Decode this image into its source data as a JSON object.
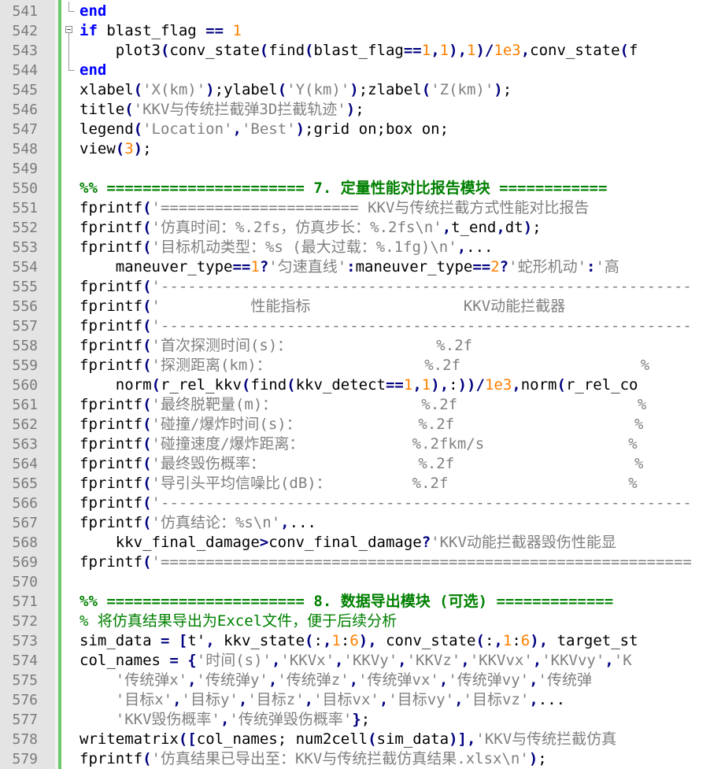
{
  "editor": {
    "lines": [
      {
        "n": "541",
        "fold": "end",
        "tokens": [
          [
            "kw",
            "end"
          ]
        ]
      },
      {
        "n": "542",
        "fold": "start",
        "tokens": [
          [
            "kw",
            "if"
          ],
          [
            "p",
            " blast_flag "
          ],
          [
            "op",
            "=="
          ],
          [
            "p",
            " "
          ],
          [
            "num",
            "1"
          ]
        ]
      },
      {
        "n": "543",
        "fold": "vline",
        "tokens": [
          [
            "p",
            "    plot3"
          ],
          [
            "op",
            "("
          ],
          [
            "p",
            "conv_state"
          ],
          [
            "op",
            "("
          ],
          [
            "p",
            "find"
          ],
          [
            "op",
            "("
          ],
          [
            "p",
            "blast_flag"
          ],
          [
            "op",
            "=="
          ],
          [
            "num",
            "1"
          ],
          [
            "op",
            ","
          ],
          [
            "num",
            "1"
          ],
          [
            "op",
            ")"
          ],
          [
            "op",
            ","
          ],
          [
            "num",
            "1"
          ],
          [
            "op",
            ")"
          ],
          [
            "op",
            "/"
          ],
          [
            "num",
            "1e3"
          ],
          [
            "op",
            ","
          ],
          [
            "p",
            "conv_state"
          ],
          [
            "op",
            "("
          ],
          [
            "p",
            "f"
          ]
        ]
      },
      {
        "n": "544",
        "fold": "end",
        "tokens": [
          [
            "kw",
            "end"
          ]
        ]
      },
      {
        "n": "545",
        "fold": "",
        "tokens": [
          [
            "p",
            "xlabel"
          ],
          [
            "op",
            "("
          ],
          [
            "str",
            "'X(km)'"
          ],
          [
            "op",
            ")"
          ],
          [
            "p",
            ";ylabel"
          ],
          [
            "op",
            "("
          ],
          [
            "str",
            "'Y(km)'"
          ],
          [
            "op",
            ")"
          ],
          [
            "p",
            ";zlabel"
          ],
          [
            "op",
            "("
          ],
          [
            "str",
            "'Z(km)'"
          ],
          [
            "op",
            ")"
          ],
          [
            "p",
            ";"
          ]
        ]
      },
      {
        "n": "546",
        "fold": "",
        "tokens": [
          [
            "p",
            "title"
          ],
          [
            "op",
            "("
          ],
          [
            "str",
            "'KKV与传统拦截弹3D拦截轨迹'"
          ],
          [
            "op",
            ")"
          ],
          [
            "p",
            ";"
          ]
        ]
      },
      {
        "n": "547",
        "fold": "",
        "tokens": [
          [
            "p",
            "legend"
          ],
          [
            "op",
            "("
          ],
          [
            "str",
            "'Location'"
          ],
          [
            "op",
            ","
          ],
          [
            "str",
            "'Best'"
          ],
          [
            "op",
            ")"
          ],
          [
            "p",
            ";grid on;box on;"
          ]
        ]
      },
      {
        "n": "548",
        "fold": "",
        "tokens": [
          [
            "p",
            "view"
          ],
          [
            "op",
            "("
          ],
          [
            "num",
            "3"
          ],
          [
            "op",
            ")"
          ],
          [
            "p",
            ";"
          ]
        ]
      },
      {
        "n": "549",
        "fold": "",
        "tokens": []
      },
      {
        "n": "550",
        "fold": "",
        "tokens": [
          [
            "cmtb",
            "%% ====================== 7. 定量性能对比报告模块 ============"
          ]
        ]
      },
      {
        "n": "551",
        "fold": "",
        "tokens": [
          [
            "p",
            "fprintf"
          ],
          [
            "op",
            "("
          ],
          [
            "str",
            "'====================== KKV与传统拦截方式性能对比报告"
          ]
        ]
      },
      {
        "n": "552",
        "fold": "",
        "tokens": [
          [
            "p",
            "fprintf"
          ],
          [
            "op",
            "("
          ],
          [
            "str",
            "'仿真时间：%.2fs，仿真步长：%.2fs\\n'"
          ],
          [
            "op",
            ","
          ],
          [
            "p",
            "t_end"
          ],
          [
            "op",
            ","
          ],
          [
            "p",
            "dt"
          ],
          [
            "op",
            ")"
          ],
          [
            "p",
            ";"
          ]
        ]
      },
      {
        "n": "553",
        "fold": "",
        "tokens": [
          [
            "p",
            "fprintf"
          ],
          [
            "op",
            "("
          ],
          [
            "str",
            "'目标机动类型：%s (最大过载：%.1fg)\\n'"
          ],
          [
            "op",
            ","
          ],
          [
            "p",
            "..."
          ]
        ]
      },
      {
        "n": "554",
        "fold": "",
        "tokens": [
          [
            "p",
            "    maneuver_type"
          ],
          [
            "op",
            "=="
          ],
          [
            "num",
            "1"
          ],
          [
            "op",
            "?"
          ],
          [
            "str",
            "'匀速直线'"
          ],
          [
            "op",
            ":"
          ],
          [
            "p",
            "maneuver_type"
          ],
          [
            "op",
            "=="
          ],
          [
            "num",
            "2"
          ],
          [
            "op",
            "?"
          ],
          [
            "str",
            "'蛇形机动'"
          ],
          [
            "op",
            ":"
          ],
          [
            "str",
            "'高"
          ]
        ]
      },
      {
        "n": "555",
        "fold": "",
        "tokens": [
          [
            "p",
            "fprintf"
          ],
          [
            "op",
            "("
          ],
          [
            "str",
            "'-----------------------------------------------------------"
          ]
        ]
      },
      {
        "n": "556",
        "fold": "",
        "tokens": [
          [
            "p",
            "fprintf"
          ],
          [
            "op",
            "("
          ],
          [
            "str",
            "'          性能指标                 KKV动能拦截器"
          ]
        ]
      },
      {
        "n": "557",
        "fold": "",
        "tokens": [
          [
            "p",
            "fprintf"
          ],
          [
            "op",
            "("
          ],
          [
            "str",
            "'-----------------------------------------------------------"
          ]
        ]
      },
      {
        "n": "558",
        "fold": "",
        "tokens": [
          [
            "p",
            "fprintf"
          ],
          [
            "op",
            "("
          ],
          [
            "str",
            "'首次探测时间(s)：                %.2f"
          ]
        ]
      },
      {
        "n": "559",
        "fold": "",
        "tokens": [
          [
            "p",
            "fprintf"
          ],
          [
            "op",
            "("
          ],
          [
            "str",
            "'探测距离(km)：                 %.2f                    %"
          ]
        ]
      },
      {
        "n": "560",
        "fold": "",
        "tokens": [
          [
            "p",
            "    norm"
          ],
          [
            "op",
            "("
          ],
          [
            "p",
            "r_rel_kkv"
          ],
          [
            "op",
            "("
          ],
          [
            "p",
            "find"
          ],
          [
            "op",
            "("
          ],
          [
            "p",
            "kkv_detect"
          ],
          [
            "op",
            "=="
          ],
          [
            "num",
            "1"
          ],
          [
            "op",
            ","
          ],
          [
            "num",
            "1"
          ],
          [
            "op",
            ")"
          ],
          [
            "op",
            ","
          ],
          [
            "p",
            ":"
          ],
          [
            "op",
            ")"
          ],
          [
            "op",
            ")"
          ],
          [
            "op",
            "/"
          ],
          [
            "num",
            "1e3"
          ],
          [
            "op",
            ","
          ],
          [
            "p",
            "norm"
          ],
          [
            "op",
            "("
          ],
          [
            "p",
            "r_rel_co"
          ]
        ]
      },
      {
        "n": "561",
        "fold": "",
        "tokens": [
          [
            "p",
            "fprintf"
          ],
          [
            "op",
            "("
          ],
          [
            "str",
            "'最终脱靶量(m)：                %.2f                    %"
          ]
        ]
      },
      {
        "n": "562",
        "fold": "",
        "tokens": [
          [
            "p",
            "fprintf"
          ],
          [
            "op",
            "("
          ],
          [
            "str",
            "'碰撞/爆炸时间(s)：             %.2f                    %"
          ]
        ]
      },
      {
        "n": "563",
        "fold": "",
        "tokens": [
          [
            "p",
            "fprintf"
          ],
          [
            "op",
            "("
          ],
          [
            "str",
            "'碰撞速度/爆炸距离：            %.2fkm/s                %"
          ]
        ]
      },
      {
        "n": "564",
        "fold": "",
        "tokens": [
          [
            "p",
            "fprintf"
          ],
          [
            "op",
            "("
          ],
          [
            "str",
            "'最终毁伤概率：                 %.2f                    %"
          ]
        ]
      },
      {
        "n": "565",
        "fold": "",
        "tokens": [
          [
            "p",
            "fprintf"
          ],
          [
            "op",
            "("
          ],
          [
            "str",
            "'导引头平均信噪比(dB)：         %.2f                    %"
          ]
        ]
      },
      {
        "n": "566",
        "fold": "",
        "tokens": [
          [
            "p",
            "fprintf"
          ],
          [
            "op",
            "("
          ],
          [
            "str",
            "'-----------------------------------------------------------"
          ]
        ]
      },
      {
        "n": "567",
        "fold": "",
        "tokens": [
          [
            "p",
            "fprintf"
          ],
          [
            "op",
            "("
          ],
          [
            "str",
            "'仿真结论：%s\\n'"
          ],
          [
            "op",
            ","
          ],
          [
            "p",
            "..."
          ]
        ]
      },
      {
        "n": "568",
        "fold": "",
        "tokens": [
          [
            "p",
            "    kkv_final_damage"
          ],
          [
            "op",
            ">"
          ],
          [
            "p",
            "conv_final_damage"
          ],
          [
            "op",
            "?"
          ],
          [
            "str",
            "'KKV动能拦截器毁伤性能显"
          ]
        ]
      },
      {
        "n": "569",
        "fold": "",
        "tokens": [
          [
            "p",
            "fprintf"
          ],
          [
            "op",
            "("
          ],
          [
            "str",
            "'==========================================================="
          ]
        ]
      },
      {
        "n": "570",
        "fold": "",
        "tokens": []
      },
      {
        "n": "571",
        "fold": "",
        "tokens": [
          [
            "cmtb",
            "%% ====================== 8. 数据导出模块 (可选) ============="
          ]
        ]
      },
      {
        "n": "572",
        "fold": "",
        "tokens": [
          [
            "cmt",
            "% 将仿真结果导出为Excel文件，便于后续分析"
          ]
        ]
      },
      {
        "n": "573",
        "fold": "",
        "tokens": [
          [
            "p",
            "sim_data "
          ],
          [
            "op",
            "="
          ],
          [
            "p",
            " "
          ],
          [
            "op",
            "["
          ],
          [
            "p",
            "t'"
          ],
          [
            "op",
            ","
          ],
          [
            "p",
            " kkv_state"
          ],
          [
            "op",
            "("
          ],
          [
            "p",
            ":"
          ],
          [
            "op",
            ","
          ],
          [
            "num",
            "1"
          ],
          [
            "p",
            ":"
          ],
          [
            "num",
            "6"
          ],
          [
            "op",
            ")"
          ],
          [
            "op",
            ","
          ],
          [
            "p",
            " conv_state"
          ],
          [
            "op",
            "("
          ],
          [
            "p",
            ":"
          ],
          [
            "op",
            ","
          ],
          [
            "num",
            "1"
          ],
          [
            "p",
            ":"
          ],
          [
            "num",
            "6"
          ],
          [
            "op",
            ")"
          ],
          [
            "op",
            ","
          ],
          [
            "p",
            " target_st"
          ]
        ]
      },
      {
        "n": "574",
        "fold": "",
        "tokens": [
          [
            "p",
            "col_names "
          ],
          [
            "op",
            "="
          ],
          [
            "p",
            " "
          ],
          [
            "op",
            "{"
          ],
          [
            "str",
            "'时间(s)'"
          ],
          [
            "op",
            ","
          ],
          [
            "str",
            "'KKVx'"
          ],
          [
            "op",
            ","
          ],
          [
            "str",
            "'KKVy'"
          ],
          [
            "op",
            ","
          ],
          [
            "str",
            "'KKVz'"
          ],
          [
            "op",
            ","
          ],
          [
            "str",
            "'KKVvx'"
          ],
          [
            "op",
            ","
          ],
          [
            "str",
            "'KKVvy'"
          ],
          [
            "op",
            ","
          ],
          [
            "str",
            "'K"
          ]
        ]
      },
      {
        "n": "575",
        "fold": "",
        "tokens": [
          [
            "p",
            "    "
          ],
          [
            "str",
            "'传统弹x'"
          ],
          [
            "op",
            ","
          ],
          [
            "str",
            "'传统弹y'"
          ],
          [
            "op",
            ","
          ],
          [
            "str",
            "'传统弹z'"
          ],
          [
            "op",
            ","
          ],
          [
            "str",
            "'传统弹vx'"
          ],
          [
            "op",
            ","
          ],
          [
            "str",
            "'传统弹vy'"
          ],
          [
            "op",
            ","
          ],
          [
            "str",
            "'传统弹"
          ]
        ]
      },
      {
        "n": "576",
        "fold": "",
        "tokens": [
          [
            "p",
            "    "
          ],
          [
            "str",
            "'目标x'"
          ],
          [
            "op",
            ","
          ],
          [
            "str",
            "'目标y'"
          ],
          [
            "op",
            ","
          ],
          [
            "str",
            "'目标z'"
          ],
          [
            "op",
            ","
          ],
          [
            "str",
            "'目标vx'"
          ],
          [
            "op",
            ","
          ],
          [
            "str",
            "'目标vy'"
          ],
          [
            "op",
            ","
          ],
          [
            "str",
            "'目标vz'"
          ],
          [
            "op",
            ","
          ],
          [
            "p",
            "..."
          ]
        ]
      },
      {
        "n": "577",
        "fold": "",
        "tokens": [
          [
            "p",
            "    "
          ],
          [
            "str",
            "'KKV毁伤概率'"
          ],
          [
            "op",
            ","
          ],
          [
            "str",
            "'传统弹毁伤概率'"
          ],
          [
            "op",
            "}"
          ],
          [
            "p",
            ";"
          ]
        ]
      },
      {
        "n": "578",
        "fold": "",
        "tokens": [
          [
            "p",
            "writematrix"
          ],
          [
            "op",
            "("
          ],
          [
            "op",
            "["
          ],
          [
            "p",
            "col_names; num2cell"
          ],
          [
            "op",
            "("
          ],
          [
            "p",
            "sim_data"
          ],
          [
            "op",
            ")"
          ],
          [
            "op",
            "]"
          ],
          [
            "op",
            ","
          ],
          [
            "str",
            "'KKV与传统拦截仿真"
          ]
        ]
      },
      {
        "n": "579",
        "fold": "",
        "tokens": [
          [
            "p",
            "fprintf"
          ],
          [
            "op",
            "("
          ],
          [
            "str",
            "'仿真结果已导出至：KKV与传统拦截仿真结果.xlsx\\n'"
          ],
          [
            "op",
            ")"
          ],
          [
            "p",
            ";"
          ]
        ]
      }
    ]
  }
}
